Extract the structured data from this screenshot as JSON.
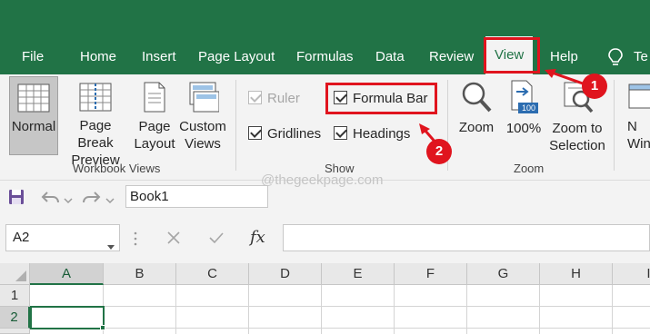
{
  "menubar": {
    "tabs": [
      {
        "label": "File"
      },
      {
        "label": "Home"
      },
      {
        "label": "Insert"
      },
      {
        "label": "Page Layout"
      },
      {
        "label": "Formulas"
      },
      {
        "label": "Data"
      },
      {
        "label": "Review"
      },
      {
        "label": "View"
      },
      {
        "label": "Help"
      },
      {
        "label": "Te"
      }
    ],
    "active_tab": "View"
  },
  "ribbon": {
    "workbook_views": {
      "group_label": "Workbook Views",
      "normal": "Normal",
      "page_break_1": "Page Break",
      "page_break_2": "Preview",
      "page_layout_1": "Page",
      "page_layout_2": "Layout",
      "custom_views_1": "Custom",
      "custom_views_2": "Views"
    },
    "show": {
      "group_label": "Show",
      "ruler": "Ruler",
      "formula_bar": "Formula Bar",
      "gridlines": "Gridlines",
      "headings": "Headings"
    },
    "zoom": {
      "group_label": "Zoom",
      "zoom": "Zoom",
      "hundred": "100%",
      "zoom_to_1": "Zoom to",
      "zoom_to_2": "Selection",
      "hundred_badge": "100"
    },
    "window": {
      "new_1": "N",
      "new_2": "Win"
    }
  },
  "qat": {
    "workbook_name": "Book1"
  },
  "formula_bar": {
    "name_box": "A2",
    "fx": "fx"
  },
  "sheet": {
    "columns": [
      "A",
      "B",
      "C",
      "D",
      "E",
      "F",
      "G",
      "H",
      "I"
    ],
    "rows": [
      "1",
      "2"
    ]
  },
  "annotations": {
    "step1": "1",
    "step2": "2",
    "watermark": "@thegeekpage.com"
  },
  "colors": {
    "excel_green": "#217346",
    "annotation_red": "#e0141e"
  }
}
